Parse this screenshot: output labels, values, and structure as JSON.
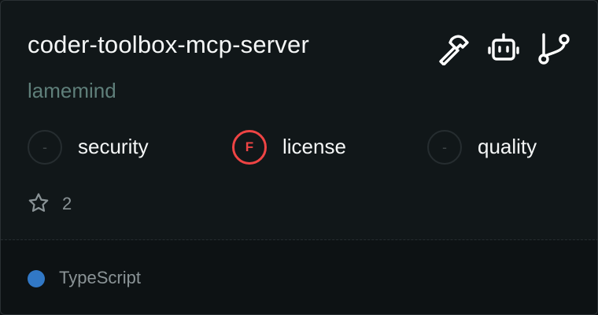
{
  "repo": {
    "name": "coder-toolbox-mcp-server",
    "owner": "lamemind"
  },
  "icons": [
    "hammer-icon",
    "robot-icon",
    "git-branch-icon"
  ],
  "scores": [
    {
      "label": "security",
      "grade": "-",
      "status": "none"
    },
    {
      "label": "license",
      "grade": "F",
      "status": "fail"
    },
    {
      "label": "quality",
      "grade": "-",
      "status": "none"
    }
  ],
  "stars": "2",
  "language": {
    "name": "TypeScript",
    "color": "#3178c6"
  },
  "colors": {
    "fail": "#ef4444",
    "owner": "#5f7f7a",
    "background": "#111719"
  }
}
